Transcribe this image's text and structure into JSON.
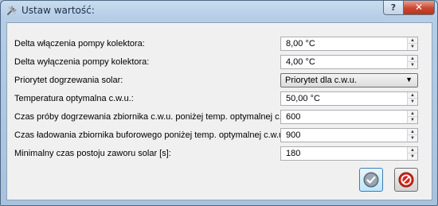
{
  "window": {
    "title": "Ustaw wartość:",
    "help_glyph": "?",
    "close_glyph": "✕"
  },
  "rows": [
    {
      "label": "Delta włączenia pompy kolektora:",
      "value": "8,00 °C"
    },
    {
      "label": "Delta wyłączenia pompy kolektora:",
      "value": "4,00 °C"
    },
    {
      "label": "Priorytet dogrzewania solar:",
      "value": "Priorytet dla c.w.u."
    },
    {
      "label": "Temperatura optymalna c.w.u.:",
      "value": "50,00 °C"
    },
    {
      "label": "Czas próby dogrzewania zbiornika c.w.u. poniżej temp. optymalnej c.w.u. [s]:",
      "value": "600"
    },
    {
      "label": "Czas ładowania zbiornika buforowego poniżej temp. optymalnej c.w.u. [s]:",
      "value": "900"
    },
    {
      "label": "Minimalny czas postoju zaworu solar [s]:",
      "value": "180"
    }
  ],
  "icons": {
    "app": "tools-icon",
    "ok": "checkmark-icon",
    "cancel": "no-entry-icon",
    "spin_up": "chevron-up-icon",
    "spin_down": "chevron-down-icon",
    "combo": "dropdown-arrow-icon"
  },
  "colors": {
    "ok_accent": "#3c7fb1",
    "cancel_red": "#d0261c",
    "close_red": "#c9472f"
  }
}
